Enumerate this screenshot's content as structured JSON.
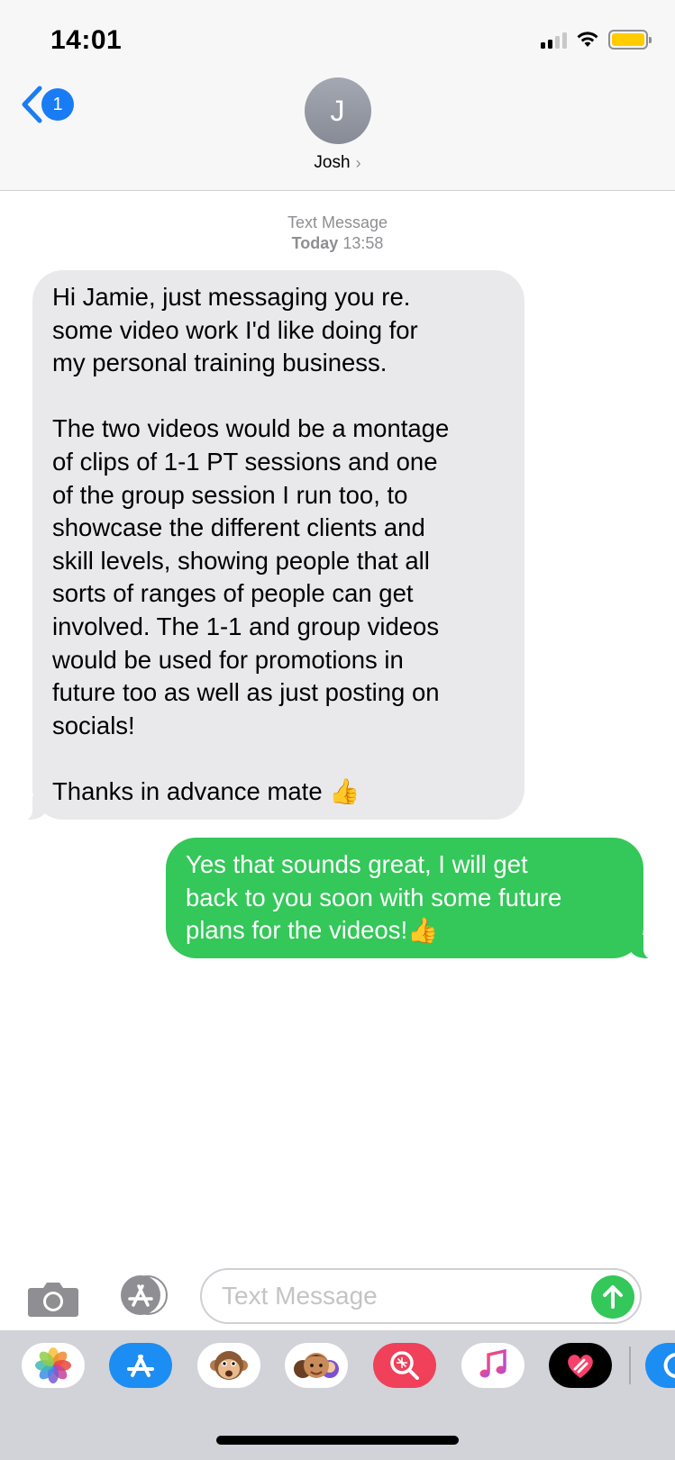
{
  "status_bar": {
    "time": "14:01",
    "battery_color": "#ffcc00"
  },
  "header": {
    "back_badge_count": "1",
    "contact_initial": "J",
    "contact_name": "Josh",
    "chevron": "›"
  },
  "thread": {
    "service_label": "Text Message",
    "date_label": "Today",
    "time_label": "13:58",
    "messages": [
      {
        "direction": "received",
        "text": "Hi Jamie, just messaging you re.\nsome video work I'd like doing for\nmy personal training business.\n\nThe two videos would be a montage\nof clips of 1-1 PT sessions and one\nof the group session I run too, to\nshowcase the different clients and\nskill levels, showing people that all\nsorts of ranges of people can get\ninvolved. The 1-1 and group videos\nwould be used for promotions in\nfuture too as well as just posting on\nsocials!\n\nThanks in advance mate 👍"
      },
      {
        "direction": "sent",
        "text": "Yes that sounds great, I will get\nback to you soon with some future\nplans for the videos!👍"
      }
    ]
  },
  "composer": {
    "placeholder": "Text Message"
  },
  "app_drawer": {
    "apps": [
      "photos-icon",
      "app-store-icon",
      "animoji-icon",
      "memoji-icon",
      "images-search-icon",
      "music-icon",
      "digital-touch-icon",
      "more-apps-icon"
    ]
  },
  "colors": {
    "sent_bubble": "#34c759",
    "received_bubble": "#e9e9eb",
    "ios_blue": "#1a7cf5"
  }
}
